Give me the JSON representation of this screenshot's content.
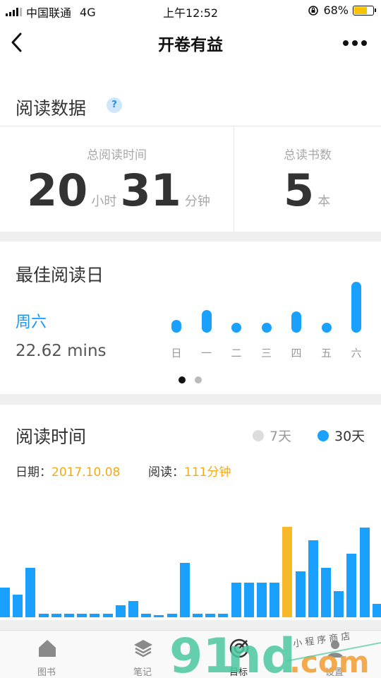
{
  "status_bar": {
    "carrier": "中国联通",
    "network": "4G",
    "time": "上午12:52",
    "battery_text": "68%",
    "battery_level": 0.68
  },
  "nav": {
    "title": "开卷有益"
  },
  "reading_data": {
    "title": "阅读数据",
    "help_label": "?",
    "total_time_label": "总阅读时间",
    "hours": "20",
    "hours_unit": "小时",
    "minutes": "31",
    "minutes_unit": "分钟",
    "total_books_label": "总读书数",
    "books": "5",
    "books_unit": "本"
  },
  "best_day": {
    "title": "最佳阅读日",
    "day": "周六",
    "minutes": "22.62 mins",
    "weekdays": [
      "日",
      "一",
      "二",
      "三",
      "四",
      "五",
      "六"
    ],
    "levels": [
      0.25,
      0.45,
      0.12,
      0.12,
      0.42,
      0.12,
      1.0
    ],
    "pages": 2,
    "active_page": 0
  },
  "reading_time": {
    "title": "阅读时间",
    "options": [
      "7天",
      "30天"
    ],
    "selected_option": 1,
    "date_label": "日期：",
    "date_value": "2017.10.08",
    "read_label": "阅读：",
    "read_value": "111分钟",
    "bar_levels": [
      0.33,
      0.25,
      0.55,
      0.04,
      0.04,
      0.04,
      0.04,
      0.04,
      0.04,
      0.13,
      0.18,
      0.04,
      0.02,
      0.04,
      0.6,
      0.04,
      0.04,
      0.04,
      0.38,
      0.38,
      0.38,
      0.38,
      1.0,
      0.51,
      0.85,
      0.55,
      0.29,
      0.7,
      0.99,
      0.15,
      0.34
    ],
    "highlight_index": 22
  },
  "colors": {
    "accent": "#1aa0ff",
    "highlight": "#f7b928",
    "inactive": "#dddddd"
  },
  "tabs": [
    {
      "label": "图书",
      "icon": "house-icon"
    },
    {
      "label": "笔记",
      "icon": "layers-icon"
    },
    {
      "label": "目标",
      "icon": "target-icon"
    },
    {
      "label": "设置",
      "icon": "settings-icon"
    }
  ],
  "watermark": {
    "brand": "91nd.com",
    "caption": "小程序商店"
  }
}
